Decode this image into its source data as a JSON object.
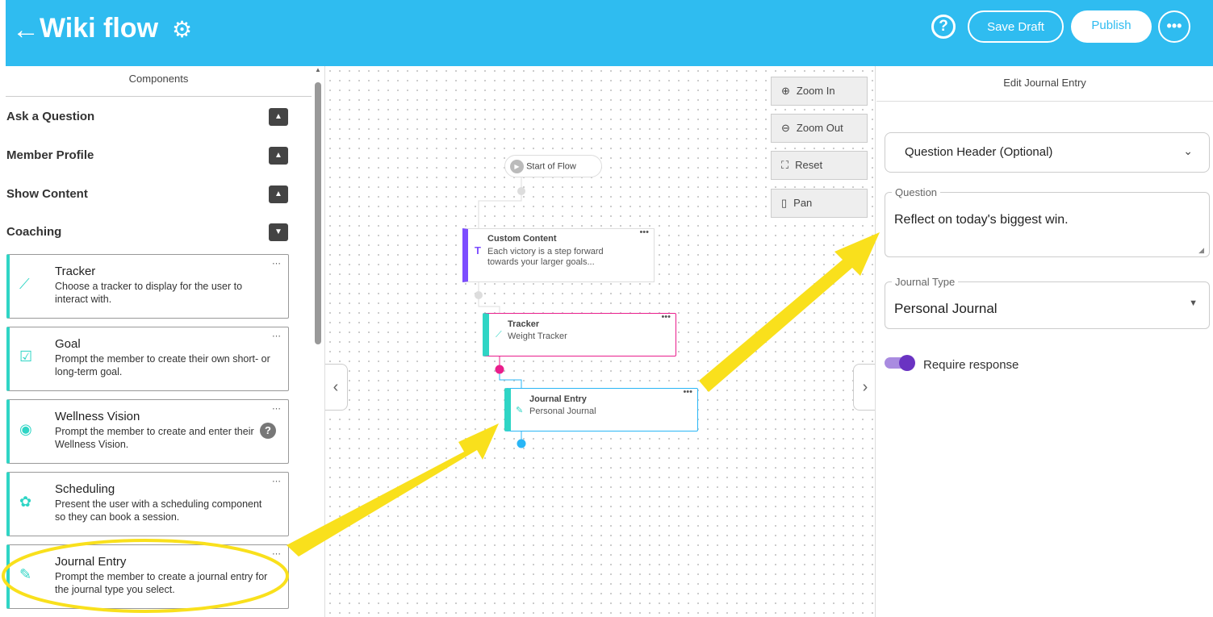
{
  "header": {
    "title": "Wiki flow",
    "save_draft": "Save Draft",
    "publish": "Publish",
    "help": "?",
    "more": "•••"
  },
  "left": {
    "title": "Components",
    "sections": [
      {
        "label": "Ask a Question",
        "state": "collapsed"
      },
      {
        "label": "Member Profile",
        "state": "collapsed"
      },
      {
        "label": "Show Content",
        "state": "collapsed"
      },
      {
        "label": "Coaching",
        "state": "expanded"
      }
    ],
    "cards": [
      {
        "title": "Tracker",
        "desc": "Choose a tracker to display for the user to interact with.",
        "icon": "trend-icon",
        "glyph": "⟋"
      },
      {
        "title": "Goal",
        "desc": "Prompt the member to create their own short- or long-term goal.",
        "icon": "checklist-icon",
        "glyph": "☑"
      },
      {
        "title": "Wellness Vision",
        "desc": "Prompt the member to create and enter their Wellness Vision.",
        "icon": "eye-icon",
        "glyph": "◉"
      },
      {
        "title": "Scheduling",
        "desc": "Present the user with a scheduling component so they can book a session.",
        "icon": "palette-icon",
        "glyph": "✿"
      },
      {
        "title": "Journal Entry",
        "desc": "Prompt the member to create a journal entry for the journal type you select.",
        "icon": "journal-icon",
        "glyph": "✎"
      }
    ]
  },
  "canvas": {
    "zoom_in": "Zoom In",
    "zoom_out": "Zoom Out",
    "reset": "Reset",
    "pan": "Pan",
    "start": "Start of Flow",
    "nodes": [
      {
        "title": "Custom Content",
        "body": "Each victory is a step forward towards your larger goals...",
        "color": "#7c4dff"
      },
      {
        "title": "Tracker",
        "body": "Weight Tracker",
        "color": "#e91e8c"
      },
      {
        "title": "Journal Entry",
        "body": "Personal Journal",
        "color": "#29b6f6"
      }
    ]
  },
  "right": {
    "title": "Edit Journal Entry",
    "header_select": "Question Header (Optional)",
    "question_label": "Question",
    "question_value": "Reflect on today's biggest win.",
    "type_label": "Journal Type",
    "type_value": "Personal Journal",
    "require": "Require response",
    "require_on": true
  },
  "colors": {
    "brand": "#2fbcf0",
    "teal": "#2fd5c5",
    "annotation": "#f9e01c"
  }
}
